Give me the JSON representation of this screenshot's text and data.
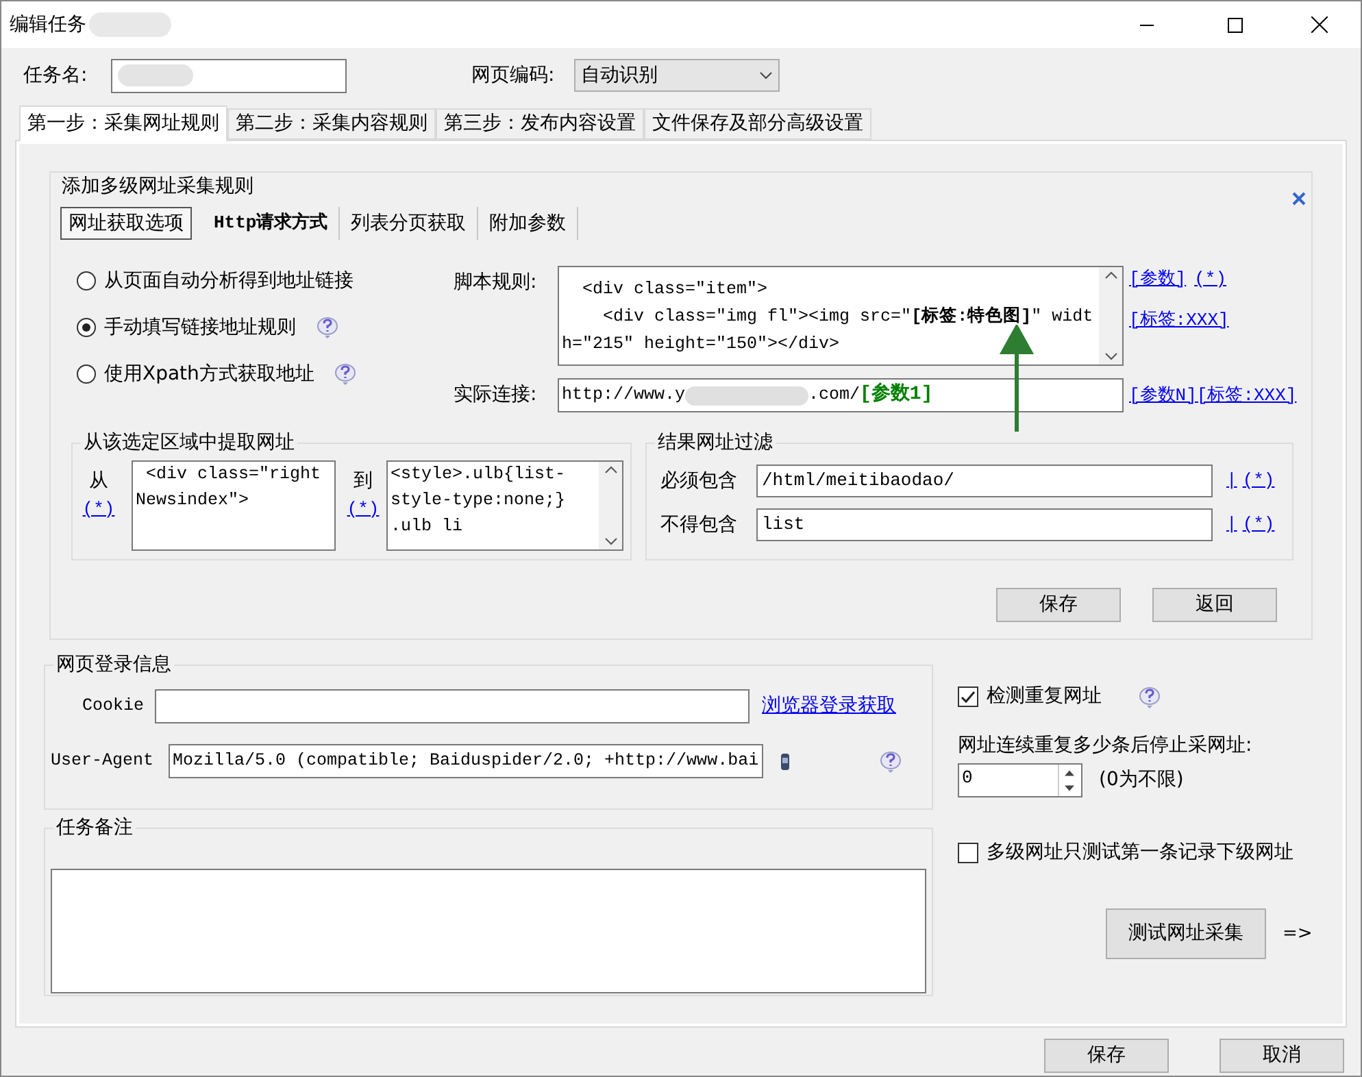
{
  "window": {
    "title": "编辑任务"
  },
  "task_name": {
    "label": "任务名:"
  },
  "encoding": {
    "label": "网页编码:",
    "value": "自动识别"
  },
  "tabs": [
    {
      "label": "第一步：采集网址规则",
      "selected": true
    },
    {
      "label": "第二步：采集内容规则",
      "selected": false
    },
    {
      "label": "第三步：发布内容设置",
      "selected": false
    },
    {
      "label": "文件保存及部分高级设置",
      "selected": false
    }
  ],
  "url_rules": {
    "title": "添加多级网址采集规则",
    "subtabs": [
      {
        "label": "网址获取选项",
        "selected": true
      },
      {
        "label": "Http请求方式",
        "selected": false
      },
      {
        "label": "列表分页获取",
        "selected": false
      },
      {
        "label": "附加参数",
        "selected": false
      }
    ],
    "methods": [
      {
        "label": "从页面自动分析得到地址链接",
        "selected": false,
        "help": false
      },
      {
        "label": "手动填写链接地址规则",
        "selected": true,
        "help": true
      },
      {
        "label": "使用Xpath方式获取地址",
        "selected": false,
        "help": true
      }
    ],
    "script_label": "脚本规则:",
    "script_lines": [
      "  <div class=\"item\">",
      "    <div class=\"img fl\"><img src=\"**[标签:特色图]**\" width=\"215\" height=\"150\"></div>"
    ],
    "script_links": [
      [
        "[参数]",
        "(*)"
      ],
      [
        "[标签:XXX]"
      ]
    ],
    "actual_label": "实际连接:",
    "actual_url": {
      "start": "http://www.y",
      "end": ".com/",
      "param": "[参数1]"
    },
    "actual_links": [
      "[参数N]",
      "[标签:XXX]"
    ],
    "region": {
      "title": "从该选定区域中提取网址",
      "from_label": "从",
      "from_link": "(*)",
      "from_value": " <div class=\"right Newsindex\">",
      "to_label": "到",
      "to_link": "(*)",
      "to_value": "<style>.ulb{list-style-type:none;} .ulb li"
    },
    "filter": {
      "title": "结果网址过滤",
      "rows": [
        {
          "label": "必须包含",
          "value": "/html/meitibaodao/",
          "links": [
            "|",
            "(*)"
          ]
        },
        {
          "label": "不得包含",
          "value": "list",
          "links": [
            "|",
            "(*)"
          ]
        }
      ]
    },
    "buttons": [
      "保存",
      "返回"
    ]
  },
  "login": {
    "title": "网页登录信息",
    "cookie_label": "Cookie",
    "browser_link": "浏览器登录获取",
    "ua_label": "User-Agent",
    "ua_value": "Mozilla/5.0 (compatible; Baiduspider/2.0; +http://www.bai"
  },
  "notes": {
    "title": "任务备注"
  },
  "options": {
    "check_duplicate": {
      "label": "检测重复网址",
      "checked": true
    },
    "repeat_label": "网址连续重复多少条后停止采网址:",
    "repeat_value": "0",
    "repeat_hint": "(0为不限)",
    "first_only": {
      "label": "多级网址只测试第一条记录下级网址",
      "checked": false
    },
    "test_button": "测试网址采集",
    "test_arrow": "=>"
  },
  "footer_buttons": [
    "保存",
    "取消"
  ]
}
